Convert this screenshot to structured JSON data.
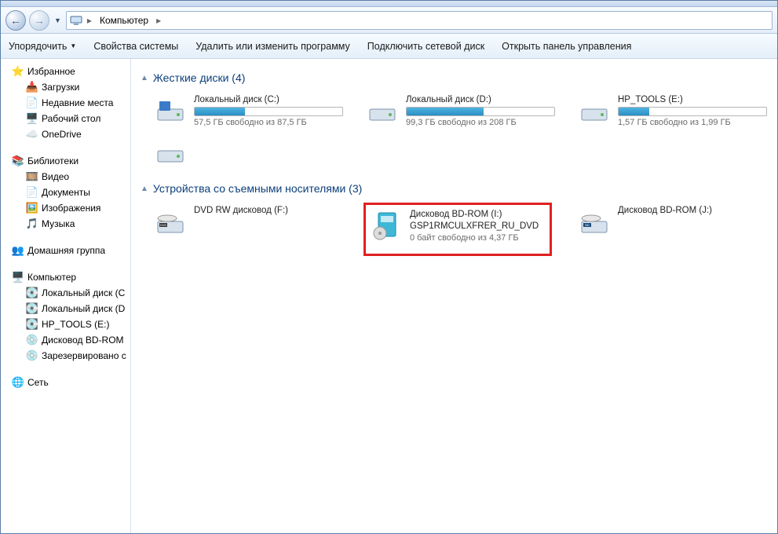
{
  "breadcrumb": {
    "root_icon": "computer-icon",
    "item": "Компьютер"
  },
  "toolbar": {
    "organize": "Упорядочить",
    "system_props": "Свойства системы",
    "uninstall": "Удалить или изменить программу",
    "map_drive": "Подключить сетевой диск",
    "control_panel": "Открыть панель управления"
  },
  "sidebar": {
    "favorites": {
      "label": "Избранное",
      "items": [
        {
          "icon": "downloads-icon",
          "label": "Загрузки"
        },
        {
          "icon": "recent-icon",
          "label": "Недавние места"
        },
        {
          "icon": "desktop-icon",
          "label": "Рабочий стол"
        },
        {
          "icon": "onedrive-icon",
          "label": "OneDrive"
        }
      ]
    },
    "libraries": {
      "label": "Библиотеки",
      "items": [
        {
          "icon": "video-icon",
          "label": "Видео"
        },
        {
          "icon": "documents-icon",
          "label": "Документы"
        },
        {
          "icon": "pictures-icon",
          "label": "Изображения"
        },
        {
          "icon": "music-icon",
          "label": "Музыка"
        }
      ]
    },
    "homegroup": {
      "label": "Домашняя группа"
    },
    "computer": {
      "label": "Компьютер",
      "items": [
        {
          "icon": "hdd-icon",
          "label": "Локальный диск (C"
        },
        {
          "icon": "hdd-icon",
          "label": "Локальный диск (D"
        },
        {
          "icon": "hdd-icon",
          "label": "HP_TOOLS (E:)"
        },
        {
          "icon": "bd-icon",
          "label": "Дисковод BD-ROM"
        },
        {
          "icon": "bd-icon",
          "label": "Зарезервировано с"
        }
      ]
    },
    "network": {
      "label": "Сеть"
    }
  },
  "sections": {
    "hdd": {
      "label": "Жесткие диски (4)",
      "count": 4
    },
    "removable": {
      "label": "Устройства со съемными носителями (3)",
      "count": 3
    }
  },
  "drives": {
    "hdd": [
      {
        "name": "Локальный диск (C:)",
        "status": "57,5 ГБ свободно из 87,5 ГБ",
        "fill_pct": 34
      },
      {
        "name": "Локальный диск (D:)",
        "status": "99,3 ГБ свободно из 208 ГБ",
        "fill_pct": 52
      },
      {
        "name": "HP_TOOLS (E:)",
        "status": "1,57 ГБ свободно из 1,99 ГБ",
        "fill_pct": 21
      }
    ],
    "hdd_extra": {
      "icon_only": true
    },
    "removable": [
      {
        "name": "DVD RW дисковод (F:)",
        "sub": "",
        "icon": "dvd"
      },
      {
        "name": "Дисковод BD-ROM (I:)",
        "sub": "GSP1RMCULXFRER_RU_DVD",
        "status": "0 байт свободно из 4,37 ГБ",
        "icon": "bd-box",
        "highlighted": true
      },
      {
        "name": "Дисковод BD-ROM (J:)",
        "sub": "",
        "icon": "bd"
      }
    ]
  }
}
